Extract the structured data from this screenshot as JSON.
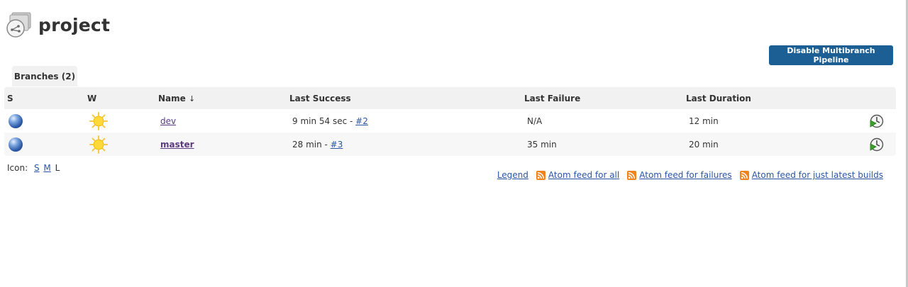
{
  "header": {
    "title": "project"
  },
  "actions": {
    "disable_label": "Disable Multibranch Pipeline"
  },
  "tabs": [
    {
      "label": "Branches (2)"
    }
  ],
  "table": {
    "headers": {
      "s": "S",
      "w": "W",
      "name": "Name",
      "sort_arrow": "↓",
      "last_success": "Last Success",
      "last_failure": "Last Failure",
      "last_duration": "Last Duration"
    },
    "rows": [
      {
        "status_icon": "blue-ball-icon",
        "weather_icon": "sunny-icon",
        "name": "dev",
        "last_success_text": "9 min 54 sec - ",
        "last_success_link": "#2",
        "last_failure": "N/A",
        "last_duration": "12 min",
        "action_icon": "schedule-build-icon"
      },
      {
        "status_icon": "blue-ball-icon",
        "weather_icon": "sunny-icon",
        "name": "master",
        "last_success_text": "28 min - ",
        "last_success_link": "#3",
        "last_failure": "35 min",
        "last_duration": "20 min",
        "action_icon": "schedule-build-icon"
      }
    ]
  },
  "icon_size": {
    "label": "Icon:",
    "small": "S",
    "medium": "M",
    "large": "L"
  },
  "footer": {
    "legend": "Legend",
    "feed_all": "Atom feed for all",
    "feed_failures": "Atom feed for failures",
    "feed_latest": "Atom feed for just latest builds"
  },
  "colors": {
    "primary_button": "#1b5f94",
    "link": "#2a55a5",
    "visited_link": "#5b3b80",
    "rss": "#f0831c"
  }
}
